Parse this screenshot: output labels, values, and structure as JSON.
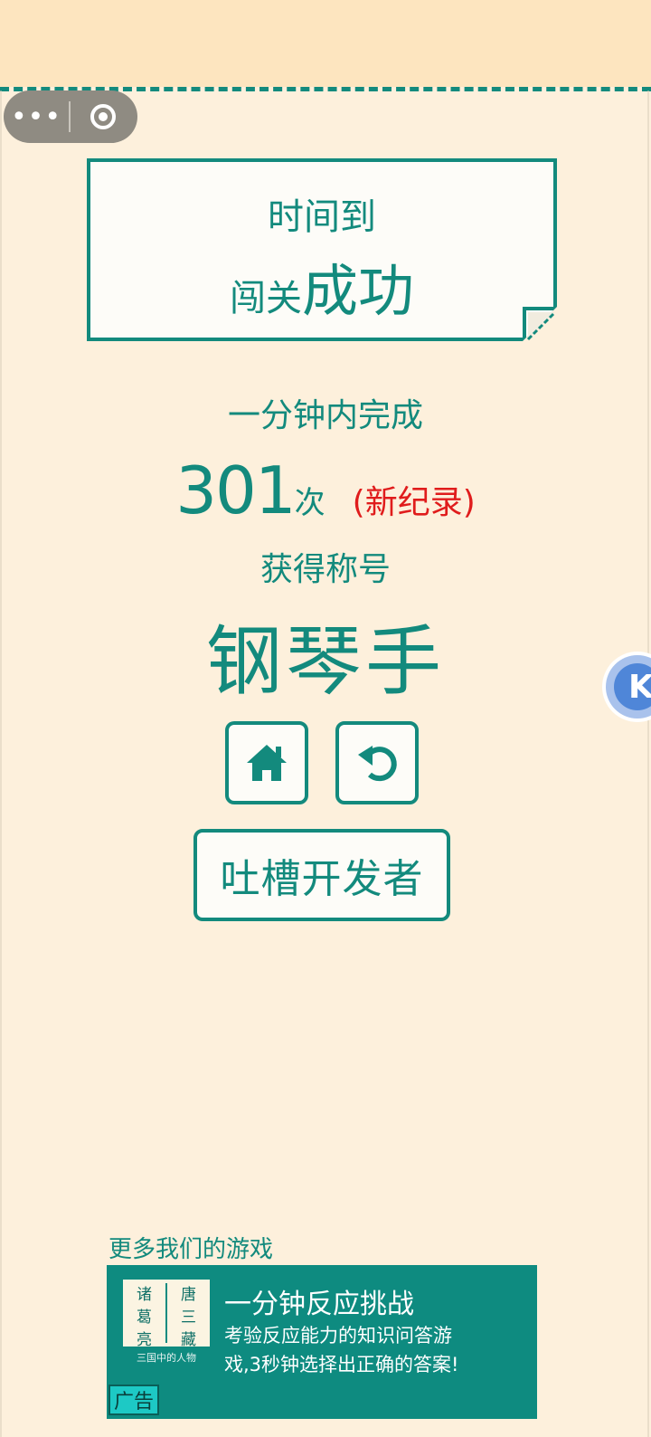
{
  "capsule": {
    "more_icon": "more-dots-icon",
    "close_icon": "target-icon"
  },
  "result": {
    "time_up": "时间到",
    "pass_prefix": "闯关",
    "pass_main": "成功"
  },
  "stats": {
    "within_label": "一分钟内完成",
    "count": "301",
    "count_unit": "次",
    "record_tag": "(新纪录)",
    "got_title_label": "获得称号",
    "title_name": "钢琴手"
  },
  "actions": {
    "home_icon": "home-icon",
    "replay_icon": "replay-icon",
    "feedback_label": "吐槽开发者"
  },
  "float_button": {
    "letter": "K"
  },
  "more_games": {
    "heading": "更多我们的游戏",
    "ad": {
      "thumb_left": [
        "诸",
        "葛",
        "亮"
      ],
      "thumb_right": [
        "唐",
        "三",
        "藏"
      ],
      "thumb_caption": "三国中的人物",
      "title": "一分钟反应挑战",
      "desc": "考验反应能力的知识问答游戏,3秒钟选择出正确的答案!",
      "badge": "广告"
    }
  },
  "colors": {
    "teal": "#138a7d",
    "record_red": "#e01c1c",
    "background": "#fdf0dc",
    "ad_bg": "#0e8b80"
  }
}
